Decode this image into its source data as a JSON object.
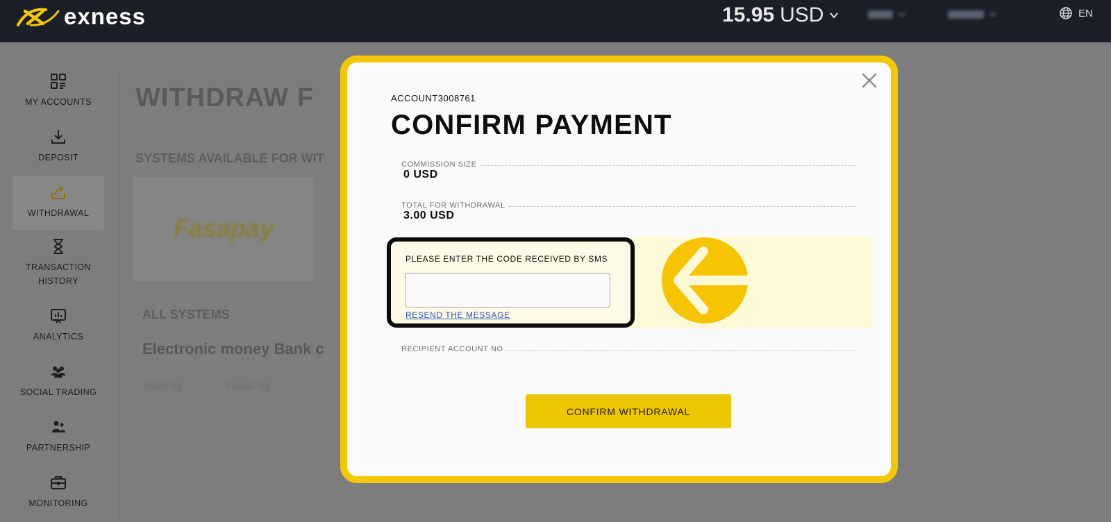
{
  "header": {
    "brand": "exness",
    "balance_amount": "15.95",
    "balance_currency": "USD",
    "language": "EN",
    "brand_color": "#f4c800"
  },
  "sidebar": {
    "items": [
      {
        "label": "MY ACCOUNTS",
        "icon": "dashboard-icon"
      },
      {
        "label": "DEPOSIT",
        "icon": "download-icon"
      },
      {
        "label": "WITHDRAWAL",
        "icon": "upload-icon",
        "active": true
      },
      {
        "label": "TRANSACTION HISTORY",
        "icon": "hourglass-icon"
      },
      {
        "label": "ANALYTICS",
        "icon": "chart-screen-icon"
      },
      {
        "label": "SOCIAL TRADING",
        "icon": "people-icon"
      },
      {
        "label": "PARTNERSHIP",
        "icon": "handshake-icon"
      },
      {
        "label": "MONITORING",
        "icon": "briefcase-icon"
      }
    ]
  },
  "background": {
    "page_title": "WITHDRAW F",
    "systems_heading": "SYSTEMS AVAILABLE FOR WIT",
    "card_logo": "Fasapay",
    "all_systems": "ALL SYSTEMS",
    "tabs": "Electronic money  Bank c",
    "pay_options": [
      "SticPay",
      "FasaPay"
    ]
  },
  "modal": {
    "account_id": "ACCOUNT3008761",
    "title": "CONFIRM PAYMENT",
    "commission_label": "COMMISSION SIZE",
    "commission_value": "0 USD",
    "total_label": "TOTAL FOR WITHDRAWAL",
    "total_value": "3.00 USD",
    "sms_label": "PLEASE ENTER THE CODE RECEIVED BY SMS",
    "sms_value": "",
    "resend_label": "RESEND THE MESSAGE",
    "recipient_label": "RECIPIENT ACCOUNT NO",
    "confirm_button": "CONFIRM WITHDRAWAL"
  }
}
